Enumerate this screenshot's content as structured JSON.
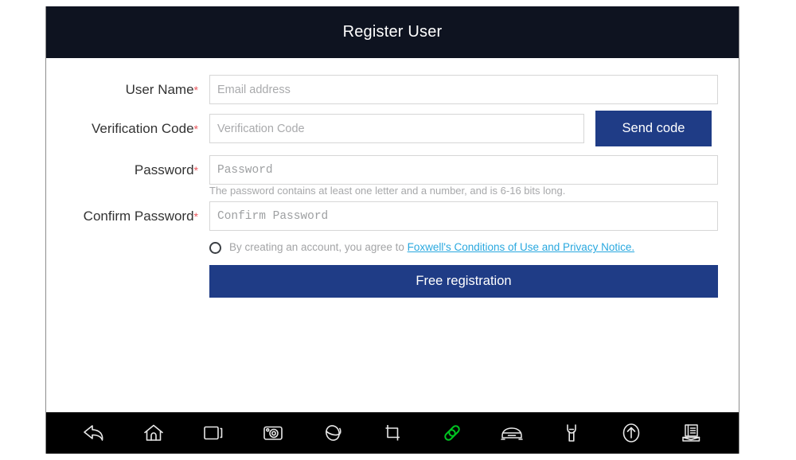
{
  "window": {
    "title": "Register User"
  },
  "colors": {
    "titlebar_bg": "#0e1320",
    "primary_button": "#1f3c86",
    "required_asterisk": "#e8545a",
    "link": "#29a8df",
    "navbar_bg": "#000000",
    "active_nav_icon": "#00c421"
  },
  "form": {
    "fields": [
      {
        "label": "User Name",
        "required_mark": "*",
        "placeholder": "Email address",
        "value": ""
      },
      {
        "label": "Verification Code",
        "required_mark": "*",
        "placeholder": "Verification Code",
        "value": ""
      },
      {
        "label": "Password",
        "required_mark": "*",
        "placeholder": "Password",
        "value": ""
      },
      {
        "label": "Confirm Password",
        "required_mark": "*",
        "placeholder": "Confirm Password",
        "value": ""
      }
    ],
    "send_code_label": "Send code",
    "password_hint": "The password contains at least one letter and a number, and is 6-16 bits long.",
    "agreement": {
      "checked": false,
      "text_before": "By creating an account, you agree to ",
      "link_text": "Foxwell's Conditions of Use and Privacy Notice."
    },
    "submit_label": "Free registration"
  },
  "navbar": {
    "items": [
      {
        "icon": "back-arrow-icon",
        "active": false
      },
      {
        "icon": "home-icon",
        "active": false
      },
      {
        "icon": "recent-apps-icon",
        "active": false
      },
      {
        "icon": "camera-icon",
        "active": false
      },
      {
        "icon": "browser-globe-icon",
        "active": false
      },
      {
        "icon": "screenshot-crop-icon",
        "active": false
      },
      {
        "icon": "link-chain-icon",
        "active": true
      },
      {
        "icon": "vehicle-car-icon",
        "active": false
      },
      {
        "icon": "wrench-tool-icon",
        "active": false
      },
      {
        "icon": "upload-arrow-icon",
        "active": false
      },
      {
        "icon": "report-document-icon",
        "active": false
      }
    ]
  }
}
